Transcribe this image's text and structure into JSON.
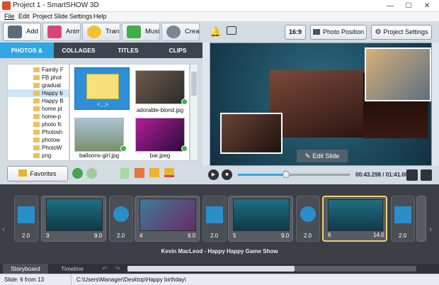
{
  "window": {
    "title": "Project 1 - SmartSHOW 3D",
    "controls": [
      "—",
      "☐",
      "✕"
    ]
  },
  "menu": [
    "File",
    "Edit",
    "Project",
    "Slide",
    "Settings",
    "Help"
  ],
  "toolbar": {
    "add": "Add",
    "animations": "Anima...",
    "transitions": "Transi...",
    "music": "Music",
    "create": "Create"
  },
  "right_toolbar": {
    "aspect": "16:9",
    "photo_position": "Photo Position",
    "project_settings": "Project Settings"
  },
  "tabs": [
    "PHOTOS & VIDEOS",
    "COLLAGES",
    "TITLES",
    "CLIPS"
  ],
  "tree": [
    "Family F",
    "FB phot",
    "graduat",
    "Happy b",
    "Happy B",
    "home pl",
    "home-p",
    "photo fc",
    "Photosh",
    "photow",
    "PhotoW",
    "png"
  ],
  "thumbs": [
    {
      "label": "<...>"
    },
    {
      "label": "adorable-blond.jpg"
    },
    {
      "label": "balloons-girl.jpg"
    },
    {
      "label": "bar.jpeg"
    }
  ],
  "favorites": "Favorites",
  "preview": {
    "edit_slide": "Edit Slide"
  },
  "playback": {
    "time": "00:43.298 / 01:41.000",
    "progress": 0.43
  },
  "storyboard": {
    "slides": [
      {
        "number": "3",
        "duration": "9.0"
      },
      {
        "number": "4",
        "duration": "9.0"
      },
      {
        "number": "5",
        "duration": "9.0"
      },
      {
        "number": "6",
        "duration": "14.0"
      }
    ],
    "transitions": [
      "2.0",
      "2.0",
      "2.0",
      "2.0",
      "2.0"
    ]
  },
  "music_track": "Kevin MacLeod - Happy Happy Game Show",
  "bottom_tabs": [
    "Storyboard",
    "Timeline"
  ],
  "status": {
    "slide": "Slide: 6 from 13",
    "path": "C:\\Users\\Manager\\Desktop\\Happy birthday\\"
  },
  "colors": {
    "accent": "#2fa7e5",
    "selected_slide": "#f0d070"
  }
}
